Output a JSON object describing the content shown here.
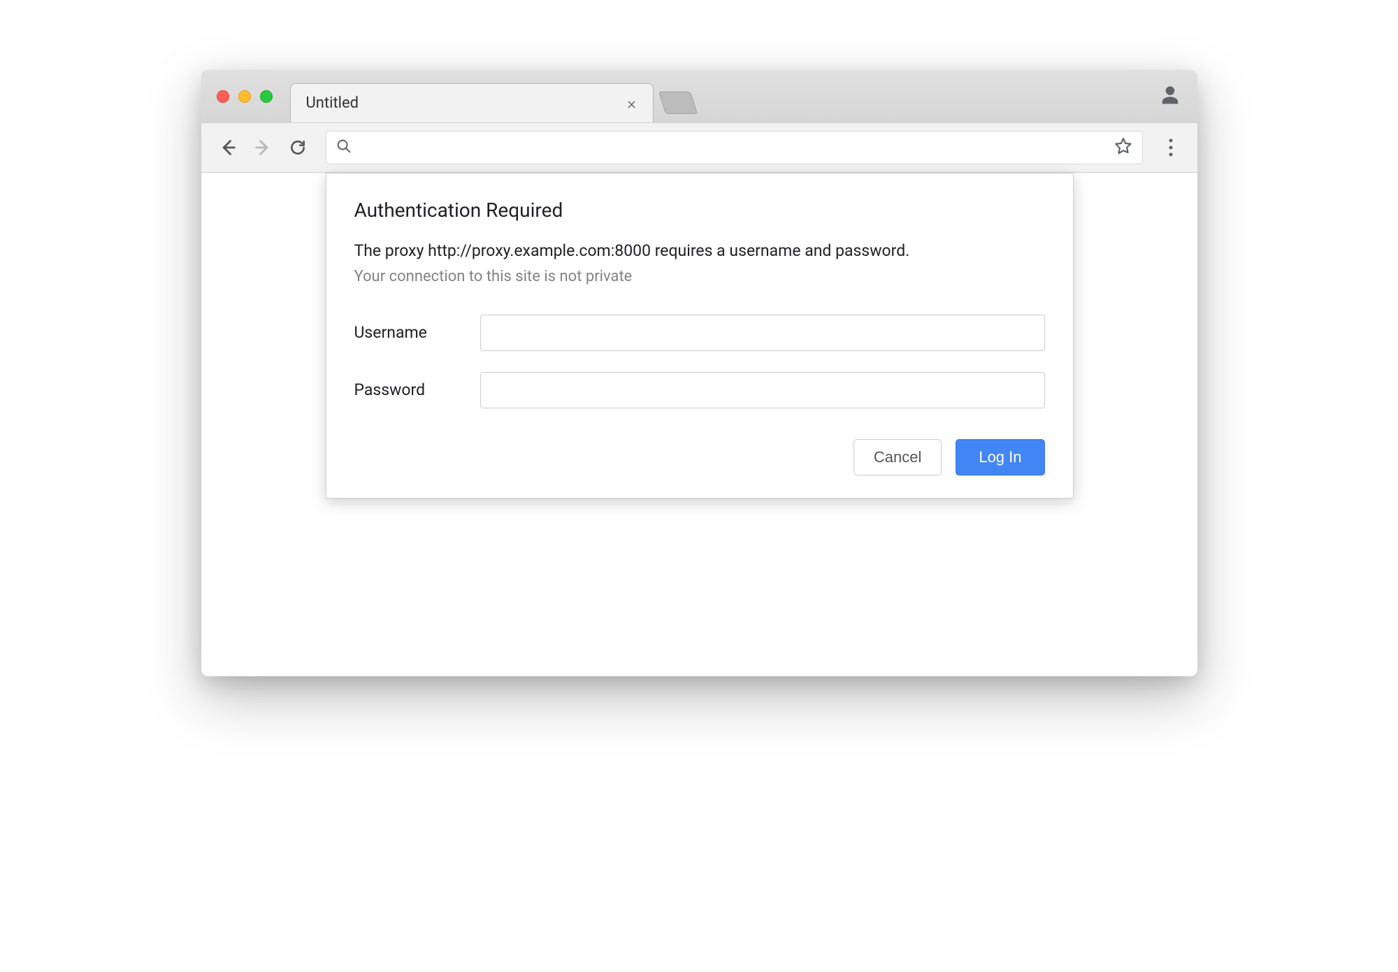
{
  "tab": {
    "title": "Untitled"
  },
  "address": {
    "value": ""
  },
  "dialog": {
    "title": "Authentication Required",
    "message": "The proxy http://proxy.example.com:8000 requires a username and password.",
    "warning": "Your connection to this site is not private",
    "username_label": "Username",
    "password_label": "Password",
    "username_value": "",
    "password_value": "",
    "cancel_label": "Cancel",
    "login_label": "Log In"
  }
}
